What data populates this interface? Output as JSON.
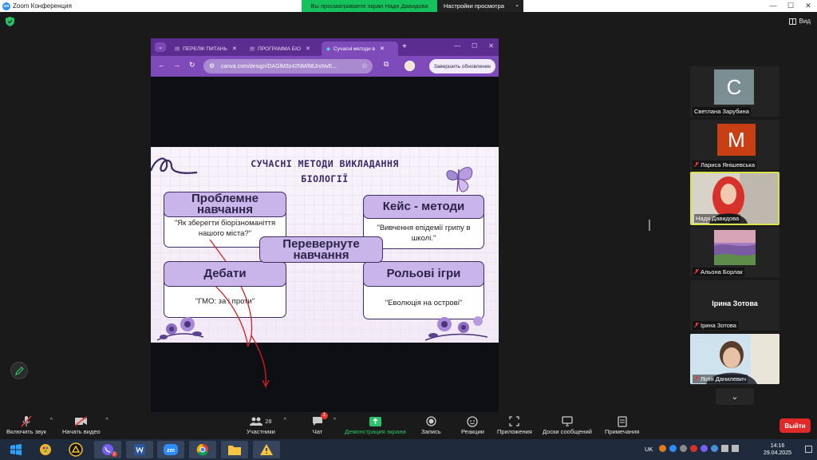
{
  "window": {
    "title": "Zoom Конференция",
    "controls": [
      "—",
      "☐",
      "✕"
    ]
  },
  "share_banner": {
    "text": "Вы просматриваете экран Надя Давидова",
    "view_options": "Настройки просмотра"
  },
  "view_button": "Вид",
  "browser": {
    "tabs": [
      {
        "label": "ПЕРЕЛІК ПИТАНЬ"
      },
      {
        "label": "ПРОГРАММА БІО"
      },
      {
        "label": "Сучасні методи в"
      }
    ],
    "url": "canva.com/design/DAGlM3z42NM/68JrxNvE...",
    "update_button": "Завершить обновление"
  },
  "slide": {
    "title_line1": "СУЧАСНІ МЕТОДИ ВИКЛАДАННЯ",
    "title_line2": "БІОЛОГІЇ",
    "cards": [
      {
        "head": "Проблемне навчання",
        "body": "\"Як зберегти біорізноманіття нашого міста?\""
      },
      {
        "head": "Кейс - методи",
        "body": "\"Вивчення епідемії грипу в школі.\""
      },
      {
        "head": "Перевернуте навчання",
        "body": ""
      },
      {
        "head": "Дебати",
        "body": "\"ГМО: за і проти\""
      },
      {
        "head": "Рольові ігри",
        "body": "\"Еволюція на острові\""
      }
    ]
  },
  "participants": [
    {
      "name": "Светлана Зарубина",
      "avatar_letter": "С",
      "avatar_color": "#7b8f93",
      "muted": false
    },
    {
      "name": "Лариса Янішевська",
      "avatar_letter": "М",
      "avatar_color": "#c93f14",
      "muted": true
    },
    {
      "name": "Надя Давидова",
      "muted": false,
      "active": true
    },
    {
      "name": "Альона Борлак",
      "muted": true
    },
    {
      "name": "Ірина Зотова",
      "muted": true
    },
    {
      "name": "Лілія Данилевич",
      "muted": true
    }
  ],
  "toolbar": {
    "mute": "Включить звук",
    "video": "Начать видео",
    "participants": "Участники",
    "participants_count": "28",
    "chat": "Чат",
    "chat_badge": "1",
    "share": "Демонстрация экрана",
    "record": "Запись",
    "reactions": "Реакции",
    "apps": "Приложения",
    "whiteboards": "Доски сообщений",
    "notes": "Примечания",
    "leave": "Выйти"
  },
  "taskbar": {
    "language": "UK",
    "time": "14:16",
    "date": "29.04.2025",
    "viber_badge": "2"
  },
  "colors": {
    "accent_green": "#15c15d",
    "browser_purple": "#7f4aba",
    "leave_red": "#e02828"
  }
}
